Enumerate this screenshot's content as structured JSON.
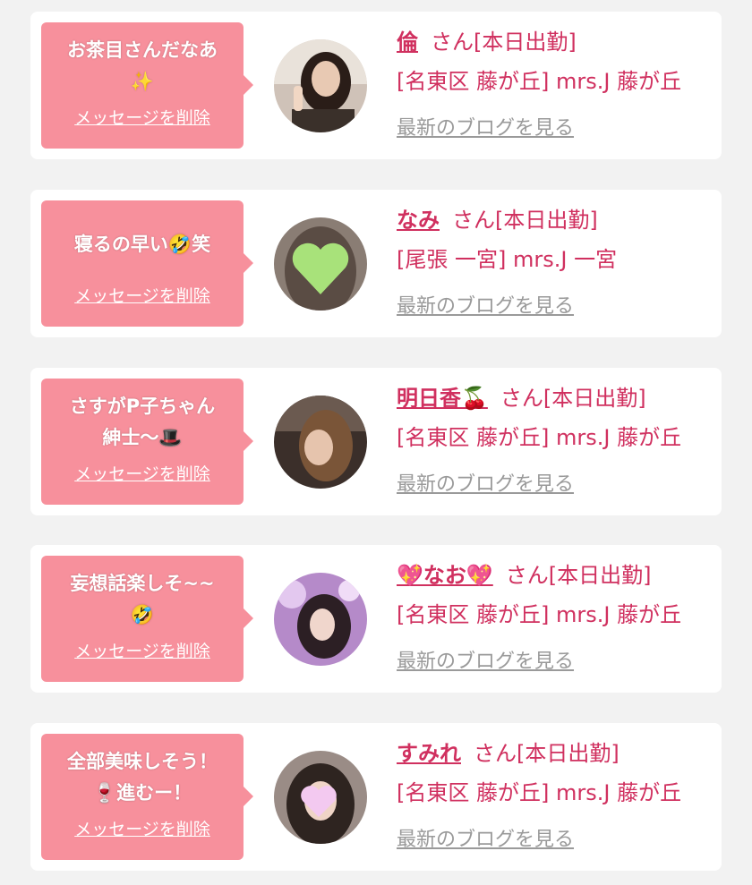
{
  "common": {
    "delete_label": "メッセージを削除",
    "blog_label": "最新のブログを見る",
    "honorific": "さん[本日出勤]"
  },
  "colors": {
    "bubble": "#f7909c",
    "accent": "#d0305f",
    "link_gray": "#9a9a9a",
    "background": "#f2f2f2"
  },
  "messages": [
    {
      "bubble_text": "お茶目さんだなあ\n✨",
      "name": "倫",
      "location": "[名東区 藤が丘] mrs.J 藤が丘",
      "avatar_icon": "photo-avatar"
    },
    {
      "bubble_text": "寝るの早い🤣笑",
      "name": "なみ",
      "location": "[尾張 一宮] mrs.J 一宮",
      "avatar_icon": "heart-sticker-avatar"
    },
    {
      "bubble_text": "さすがP子ちゃん\n紳士〜🎩",
      "name": "明日香🍒",
      "location": "[名東区 藤が丘] mrs.J 藤が丘",
      "avatar_icon": "photo-avatar"
    },
    {
      "bubble_text": "妄想話楽しそ~~\n🤣",
      "name": "💖なお💖",
      "location": "[名東区 藤が丘] mrs.J 藤が丘",
      "avatar_icon": "photo-avatar"
    },
    {
      "bubble_text": "全部美味しそう！\n🍷進むー！",
      "name": "すみれ",
      "location": "[名東区 藤が丘] mrs.J 藤が丘",
      "avatar_icon": "heart-sticker-avatar"
    }
  ]
}
